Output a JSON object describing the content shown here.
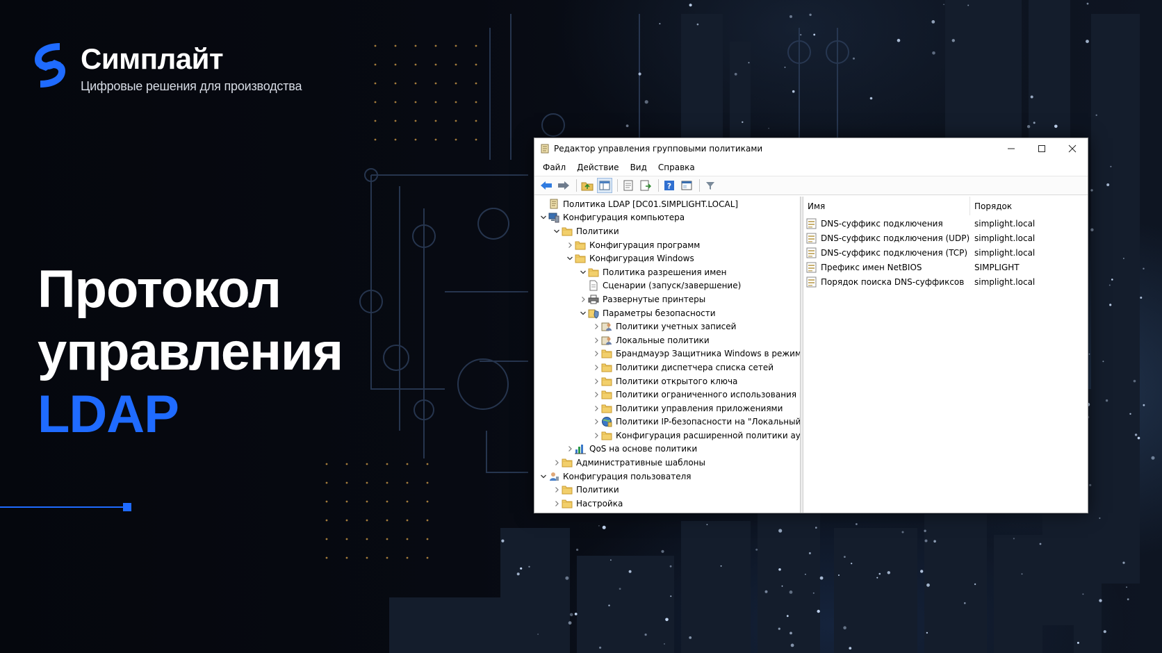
{
  "brand": {
    "name": "Симплайт",
    "tagline": "Цифровые решения для производства",
    "accent_color": "#1f6bff"
  },
  "headline": {
    "line1": "Протокол",
    "line2": "управления",
    "line3": "LDAP"
  },
  "window": {
    "title": "Редактор управления групповыми политиками",
    "menu": [
      "Файл",
      "Действие",
      "Вид",
      "Справка"
    ],
    "toolbar_icons": [
      "back-arrow-icon",
      "forward-arrow-icon",
      "up-folder-icon",
      "show-hide-tree-icon",
      "properties-icon",
      "export-list-icon",
      "help-icon",
      "console-icon",
      "filter-icon"
    ],
    "tree": [
      {
        "label": "Политика LDAP [DC01.SIMPLIGHT.LOCAL]",
        "icon": "policy-scroll-icon",
        "expander": "none"
      },
      {
        "label": "Конфигурация компьютера",
        "icon": "computer-icon",
        "expander": "expanded"
      },
      {
        "label": "Политики",
        "icon": "folder-icon",
        "expander": "expanded"
      },
      {
        "label": "Конфигурация программ",
        "icon": "folder-icon",
        "expander": "collapsed"
      },
      {
        "label": "Конфигурация Windows",
        "icon": "folder-icon",
        "expander": "expanded"
      },
      {
        "label": "Политика разрешения имен",
        "icon": "folder-icon",
        "expander": "expanded"
      },
      {
        "label": "Сценарии (запуск/завершение)",
        "icon": "script-icon",
        "expander": "none"
      },
      {
        "label": "Развернутые принтеры",
        "icon": "printer-icon",
        "expander": "collapsed"
      },
      {
        "label": "Параметры безопасности",
        "icon": "security-icon",
        "expander": "expanded"
      },
      {
        "label": "Политики учетных записей",
        "icon": "accounts-icon",
        "expander": "collapsed"
      },
      {
        "label": "Локальные политики",
        "icon": "accounts-icon",
        "expander": "collapsed"
      },
      {
        "label": "Брандмауэр Защитника Windows в режиме по",
        "icon": "folder-icon",
        "expander": "collapsed"
      },
      {
        "label": "Политики диспетчера списка сетей",
        "icon": "folder-icon",
        "expander": "collapsed"
      },
      {
        "label": "Политики открытого ключа",
        "icon": "folder-icon",
        "expander": "collapsed"
      },
      {
        "label": "Политики ограниченного использования прог",
        "icon": "folder-icon",
        "expander": "collapsed"
      },
      {
        "label": "Политики управления приложениями",
        "icon": "folder-icon",
        "expander": "collapsed"
      },
      {
        "label": "Политики IP-безопасности на \"Локальный ко",
        "icon": "ipsec-icon",
        "expander": "collapsed"
      },
      {
        "label": "Конфигурация расширенной политики аудита",
        "icon": "folder-icon",
        "expander": "collapsed"
      },
      {
        "label": "QoS на основе политики",
        "icon": "chart-bars-icon",
        "expander": "collapsed"
      },
      {
        "label": "Административные шаблоны",
        "icon": "folder-icon",
        "expander": "collapsed"
      },
      {
        "label": "Конфигурация пользователя",
        "icon": "user-icon",
        "expander": "expanded"
      },
      {
        "label": "Политики",
        "icon": "folder-icon",
        "expander": "collapsed"
      },
      {
        "label": "Настройка",
        "icon": "folder-icon",
        "expander": "collapsed"
      }
    ],
    "tree_depths": [
      0,
      0,
      1,
      2,
      2,
      3,
      3,
      3,
      3,
      4,
      4,
      4,
      4,
      4,
      4,
      4,
      4,
      4,
      2,
      1,
      0,
      1,
      1
    ],
    "list": {
      "columns": [
        "Имя",
        "Порядок"
      ],
      "rows": [
        {
          "name": "DNS-суффикс подключения",
          "order": "simplight.local"
        },
        {
          "name": "DNS-суффикс подключения (UDP)",
          "order": "simplight.local"
        },
        {
          "name": "DNS-суффикс подключения (TCP)",
          "order": "simplight.local"
        },
        {
          "name": "Префикс имен NetBIOS",
          "order": "SIMPLIGHT"
        },
        {
          "name": "Порядок поиска DNS-суффиксов",
          "order": "simplight.local"
        }
      ]
    }
  }
}
